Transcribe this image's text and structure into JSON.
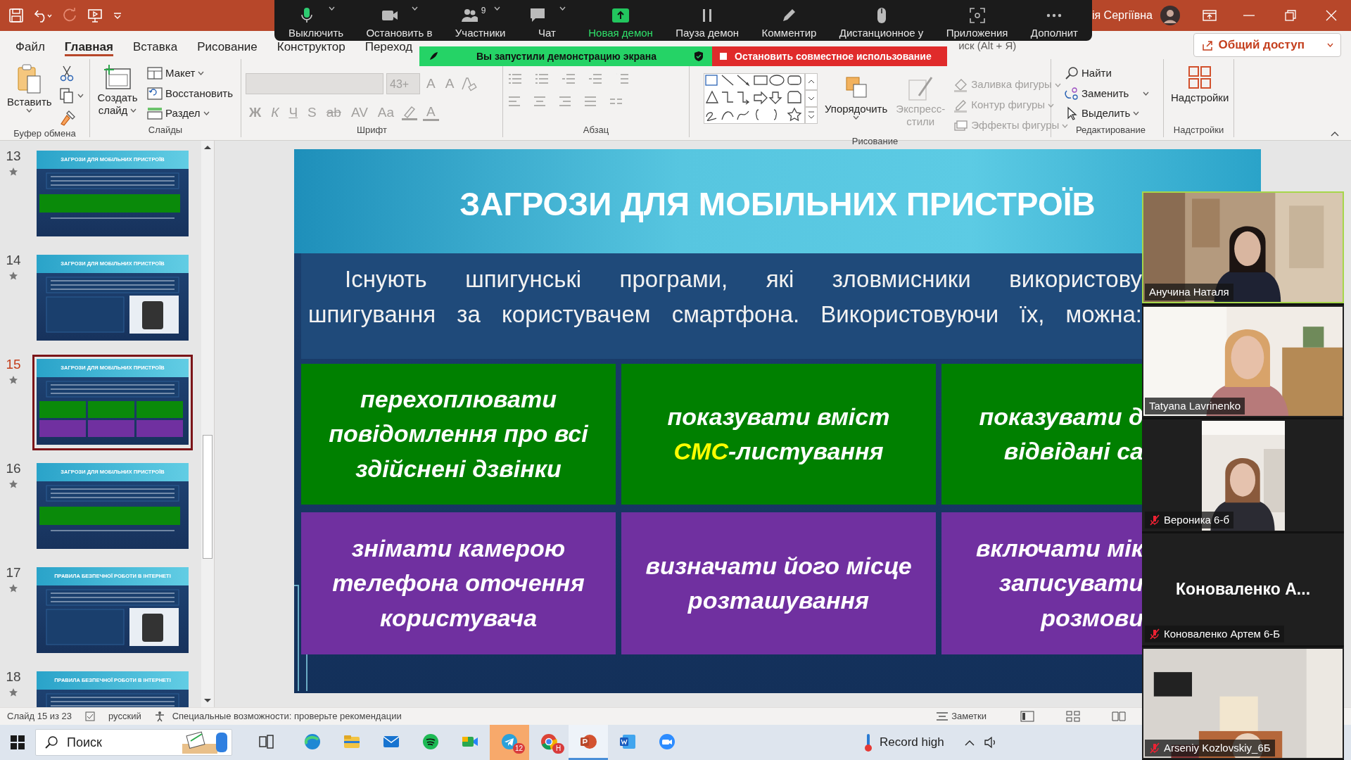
{
  "title_bar": {
    "user_name": "ія Сергіївна"
  },
  "zoom_toolbar": {
    "items": [
      {
        "kind": "mic",
        "label": "Выключить",
        "active": false
      },
      {
        "kind": "camera",
        "label": "Остановить в",
        "active": false
      },
      {
        "kind": "participants",
        "label": "Участники",
        "count": "9",
        "active": false
      },
      {
        "kind": "chat",
        "label": "Чат",
        "active": false
      },
      {
        "kind": "share",
        "label": "Новая демон",
        "active": true
      },
      {
        "kind": "pause",
        "label": "Пауза демон",
        "active": false
      },
      {
        "kind": "annotate",
        "label": "Комментир",
        "active": false
      },
      {
        "kind": "remote",
        "label": "Дистанционное у",
        "active": false
      },
      {
        "kind": "apps",
        "label": "Приложения",
        "active": false
      },
      {
        "kind": "more",
        "label": "Дополнит",
        "active": false
      }
    ]
  },
  "share_banner": {
    "status": "Вы запустили демонстрацию экрана",
    "stop_button": "Остановить совместное использование"
  },
  "ribbon_tabs": [
    {
      "label": "Файл",
      "selected": false
    },
    {
      "label": "Главная",
      "selected": true
    },
    {
      "label": "Вставка",
      "selected": false
    },
    {
      "label": "Рисование",
      "selected": false
    },
    {
      "label": "Конструктор",
      "selected": false
    },
    {
      "label": "Переход",
      "selected": false
    }
  ],
  "search_hint": "иск (Alt + Я)",
  "share_button": "Общий доступ",
  "ribbon": {
    "clipboard": {
      "label": "Буфер обмена",
      "paste": "Вставить"
    },
    "slides": {
      "label": "Слайды",
      "new_slide": "Создать слайд",
      "layout": "Макет",
      "reset": "Восстановить",
      "section": "Раздел"
    },
    "font": {
      "label": "Шрифт",
      "disabled": true,
      "size": "43+",
      "size_buttons": [
        "A",
        "A"
      ],
      "formats": [
        "Ж",
        "К",
        "Ч",
        "S",
        "ab",
        "AV",
        "Aa"
      ],
      "font_color": "A"
    },
    "paragraph": {
      "label": "Абзац",
      "disabled": true
    },
    "drawing": {
      "label": "Рисование",
      "arrange": "Упорядочить",
      "quick_styles": "Экспресс-стили",
      "fill": "Заливка фигуры",
      "outline": "Контур фигуры",
      "effects": "Эффекты фигуры",
      "styles_disabled": true
    },
    "editing": {
      "label": "Редактирование",
      "find": "Найти",
      "replace": "Заменить",
      "select": "Выделить"
    },
    "addins": {
      "label": "Надстройки",
      "button": "Надстройки"
    }
  },
  "slides_pane": [
    {
      "number": "13",
      "title": "ЗАГРОЗИ ДЛЯ МОБІЛЬНИХ ПРИСТРОЇВ",
      "selected": false
    },
    {
      "number": "14",
      "title": "ЗАГРОЗИ ДЛЯ МОБІЛЬНИХ ПРИСТРОЇВ",
      "selected": false
    },
    {
      "number": "15",
      "title": "ЗАГРОЗИ ДЛЯ МОБІЛЬНИХ ПРИСТРОЇВ",
      "selected": true
    },
    {
      "number": "16",
      "title": "ЗАГРОЗИ ДЛЯ МОБІЛЬНИХ ПРИСТРОЇВ",
      "selected": false
    },
    {
      "number": "17",
      "title": "ПРАВИЛА БЕЗПЕЧНОЇ РОБОТИ В ІНТЕРНЕТІ",
      "selected": false
    },
    {
      "number": "18",
      "title": "ПРАВИЛА БЕЗПЕЧНОЇ РОБОТИ В ІНТЕРНЕТІ",
      "selected": false
    }
  ],
  "slide": {
    "title": "ЗАГРОЗИ ДЛЯ МОБІЛЬНИХ ПРИСТРОЇВ",
    "intro": [
      "Існують шпигунські програми, які зловмисники використову",
      "шпигування за користувачем смартфона. Використовуючи їх, можна:"
    ],
    "cells": [
      {
        "color": "#008000",
        "lines": [
          [
            {
              "text": "перехоплювати"
            }
          ],
          [
            {
              "text": "повідомлення про всі"
            }
          ],
          [
            {
              "text": "здійснені дзвінки"
            }
          ]
        ]
      },
      {
        "color": "#008000",
        "lines": [
          [
            {
              "text": "показувати вміст"
            }
          ],
          [
            {
              "text": "СМС",
              "accent": true
            },
            {
              "text": "-листування"
            }
          ]
        ]
      },
      {
        "color": "#008000",
        "lines": [
          [
            {
              "text": "показувати д"
            }
          ],
          [
            {
              "text": "відвідані са"
            }
          ]
        ]
      },
      {
        "color": "#7030a0",
        "lines": [
          [
            {
              "text": "знімати камерою"
            }
          ],
          [
            {
              "text": "телефона оточення"
            }
          ],
          [
            {
              "text": "користувача"
            }
          ]
        ]
      },
      {
        "color": "#7030a0",
        "lines": [
          [
            {
              "text": "визначати його місце"
            }
          ],
          [
            {
              "text": "розташування"
            }
          ]
        ]
      },
      {
        "color": "#7030a0",
        "lines": [
          [
            {
              "text": "включати мік"
            }
          ],
          [
            {
              "text": "записувати"
            }
          ],
          [
            {
              "text": "розмови"
            }
          ]
        ]
      }
    ]
  },
  "participants": [
    {
      "name": "Анучина Наталя",
      "muted": false,
      "speaking": true,
      "kind": "video"
    },
    {
      "name": "Tatyana Lavrinenko",
      "muted": false,
      "speaking": false,
      "kind": "video"
    },
    {
      "name": "Вероника 6-б",
      "muted": true,
      "speaking": false,
      "kind": "portrait"
    },
    {
      "name": "Коноваленко Артем 6-Б",
      "muted": true,
      "speaking": false,
      "kind": "no_video",
      "display_name": "Коноваленко А..."
    },
    {
      "name": "Arseniy Kozlovskiy_6Б",
      "muted": true,
      "speaking": false,
      "kind": "video"
    }
  ],
  "status_bar": {
    "slide_counter": "Слайд 15 из 23",
    "language": "русский",
    "accessibility": "Специальные возможности: проверьте рекомендации",
    "notes": "Заметки"
  },
  "taskbar": {
    "search": "Поиск",
    "apps": [
      {
        "kind": "taskview",
        "attention": false,
        "active": false
      },
      {
        "kind": "edge",
        "attention": false,
        "active": false
      },
      {
        "kind": "explorer",
        "attention": false,
        "active": false
      },
      {
        "kind": "mail",
        "attention": false,
        "active": false
      },
      {
        "kind": "spotify",
        "attention": false,
        "active": false
      },
      {
        "kind": "meet",
        "attention": false,
        "active": false
      },
      {
        "kind": "telegram",
        "badge": "12",
        "attention": true,
        "active": false
      },
      {
        "kind": "chrome",
        "badge": "H",
        "attention": false,
        "active": false
      },
      {
        "kind": "powerpoint",
        "attention": false,
        "active": true
      },
      {
        "kind": "word",
        "attention": false,
        "active": false
      },
      {
        "kind": "zoom",
        "attention": false,
        "active": false
      }
    ],
    "weather": "Record high"
  }
}
